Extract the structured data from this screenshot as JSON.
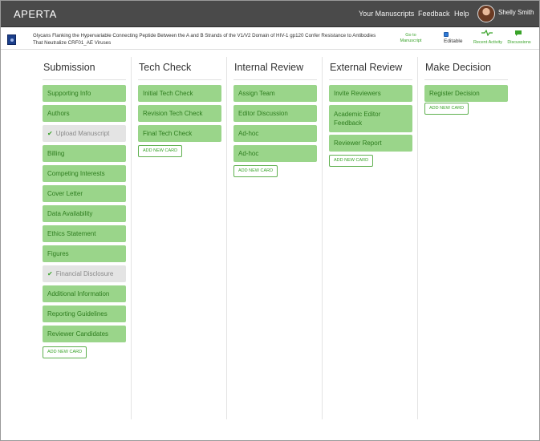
{
  "app": {
    "brand": "APERTA"
  },
  "topnav": {
    "manuscripts": "Your Manuscripts",
    "feedback": "Feedback",
    "help": "Help",
    "user": "Shelly Smith"
  },
  "manuscript": {
    "title": "Glycans Flanking the Hypervariable Connecting Peptide Between the A and B Strands of the V1/V2 Domain of HIV-1 gp120 Confer Resistance to Antibodies That Neutralize CRF01_AE Viruses",
    "goto_line1": "Go to",
    "goto_line2": "Manuscript",
    "editable": "Editable",
    "editable_checked": true,
    "recent_activity": "Recent Activity",
    "discussions": "Discussions",
    "icons": {
      "recent_activity": "pulse-icon",
      "discussions": "chat-bubble-icon",
      "journal": "journal-logo"
    }
  },
  "colors": {
    "accent": "#39a329",
    "card_bg": "#9ad58a",
    "card_text": "#2e7d1f",
    "done_bg": "#e4e4e4",
    "topbar": "#4a4a4a"
  },
  "columns": [
    {
      "title": "Submission",
      "cards": [
        {
          "label": "Supporting Info",
          "completed": false
        },
        {
          "label": "Authors",
          "completed": false
        },
        {
          "label": "Upload Manuscript",
          "completed": true
        },
        {
          "label": "Billing",
          "completed": false
        },
        {
          "label": "Competing Interests",
          "completed": false
        },
        {
          "label": "Cover Letter",
          "completed": false
        },
        {
          "label": "Data Availability",
          "completed": false
        },
        {
          "label": "Ethics Statement",
          "completed": false
        },
        {
          "label": "Figures",
          "completed": false
        },
        {
          "label": "Financial Disclosure",
          "completed": true
        },
        {
          "label": "Additional Information",
          "completed": false
        },
        {
          "label": "Reporting Guidelines",
          "completed": false
        },
        {
          "label": "Reviewer Candidates",
          "completed": false
        }
      ],
      "add": "ADD NEW CARD"
    },
    {
      "title": "Tech Check",
      "cards": [
        {
          "label": "Initial Tech Check",
          "completed": false
        },
        {
          "label": "Revision Tech Check",
          "completed": false
        },
        {
          "label": "Final Tech Check",
          "completed": false
        }
      ],
      "add": "ADD NEW CARD"
    },
    {
      "title": "Internal Review",
      "cards": [
        {
          "label": "Assign Team",
          "completed": false
        },
        {
          "label": "Editor Discussion",
          "completed": false
        },
        {
          "label": "Ad-hoc",
          "completed": false
        },
        {
          "label": "Ad-hoc",
          "completed": false
        }
      ],
      "add": "ADD NEW CARD"
    },
    {
      "title": "External Review",
      "cards": [
        {
          "label": "Invite Reviewers",
          "completed": false
        },
        {
          "label": "Academic Editor Feedback",
          "completed": false
        },
        {
          "label": "Reviewer Report",
          "completed": false
        }
      ],
      "add": "ADD NEW CARD"
    },
    {
      "title": "Make Decision",
      "cards": [
        {
          "label": "Register Decision",
          "completed": false
        }
      ],
      "add": "ADD NEW CARD"
    }
  ]
}
